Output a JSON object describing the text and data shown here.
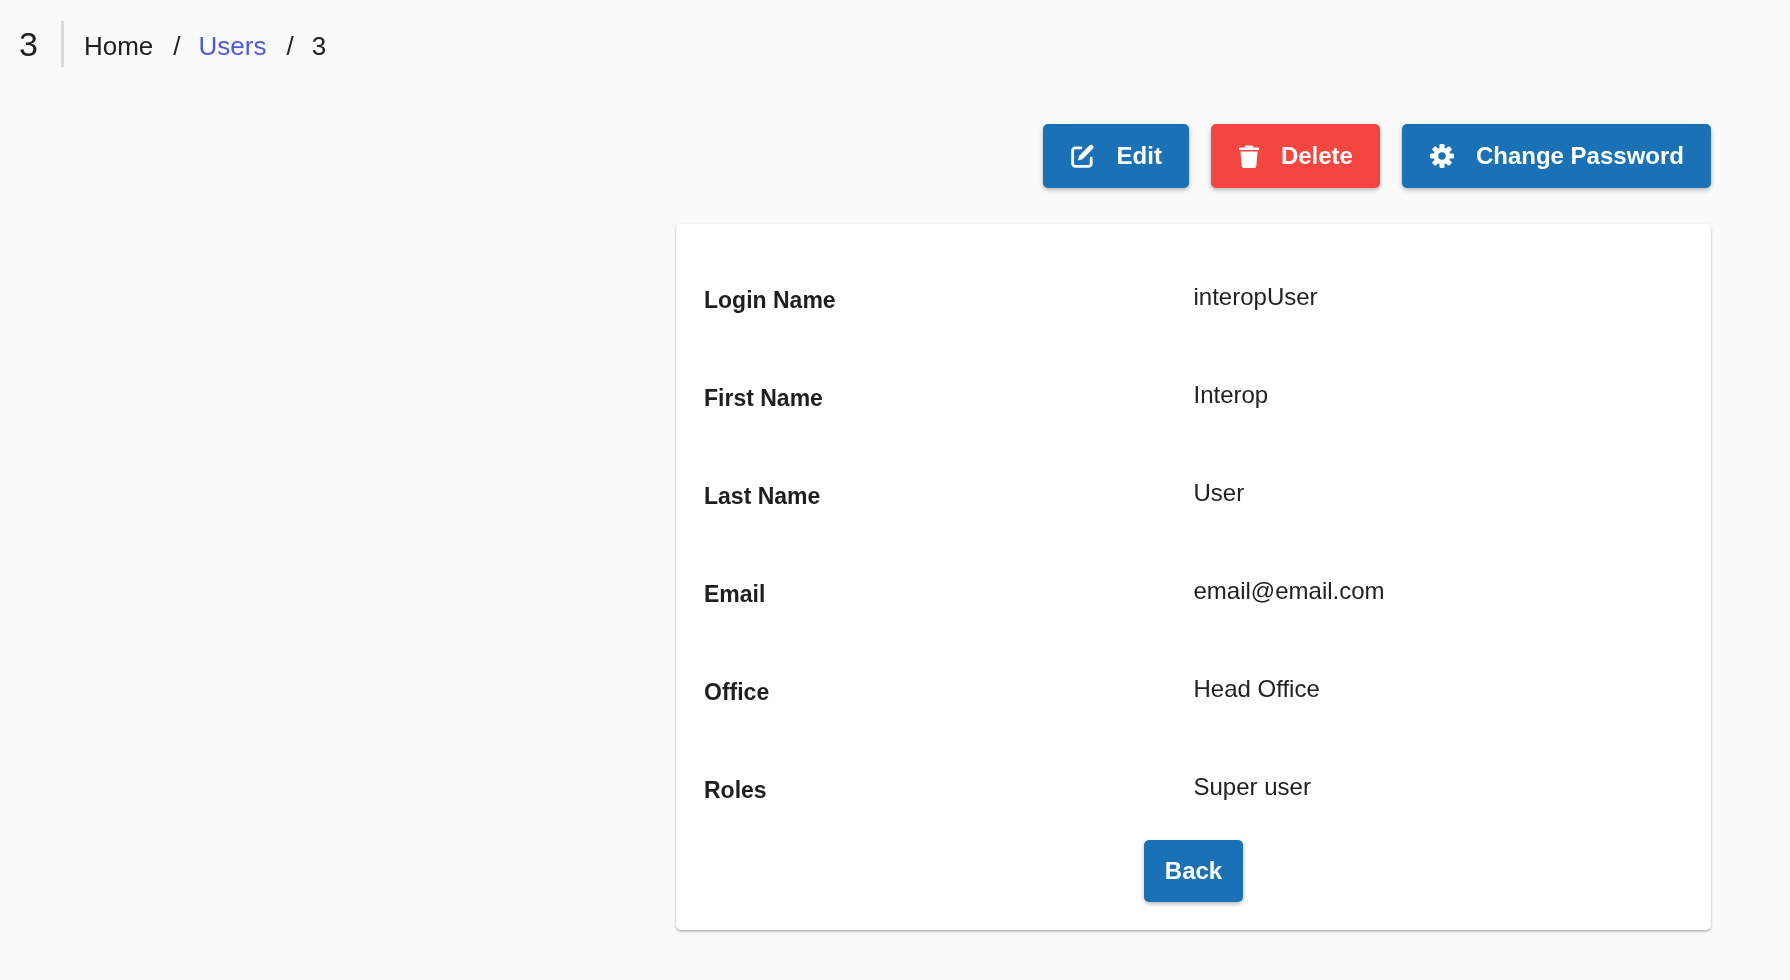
{
  "page_title": "3",
  "breadcrumb": [
    {
      "kind": "text",
      "label": "Home"
    },
    {
      "kind": "separator",
      "label": "/"
    },
    {
      "kind": "link",
      "label": "Users"
    },
    {
      "kind": "separator",
      "label": "/"
    },
    {
      "kind": "text",
      "label": "3"
    }
  ],
  "actions": [
    {
      "kind": "edit",
      "label": "Edit"
    },
    {
      "kind": "delete",
      "label": "Delete"
    },
    {
      "kind": "change_password",
      "label": "Change Password"
    }
  ],
  "details": [
    {
      "label": "Login Name",
      "value": "interopUser"
    },
    {
      "label": "First Name",
      "value": "Interop"
    },
    {
      "label": "Last Name",
      "value": "User"
    },
    {
      "label": "Email",
      "value": "email@email.com"
    },
    {
      "label": "Office",
      "value": "Head Office"
    },
    {
      "label": "Roles",
      "value": "Super user"
    }
  ],
  "back_button": {
    "label": "Back"
  }
}
